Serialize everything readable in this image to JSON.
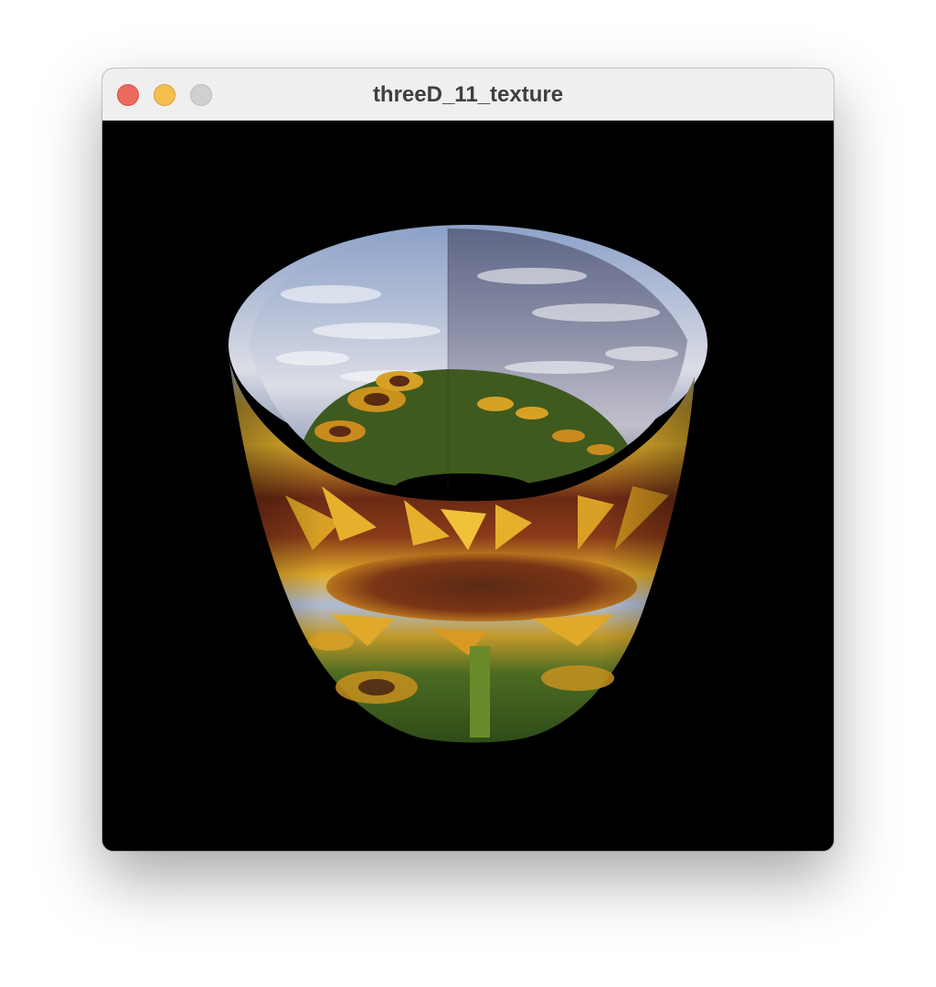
{
  "window": {
    "title": "threeD_11_texture",
    "background": "#000000"
  },
  "icons": {
    "close": "close-traffic-light",
    "minimize": "minimize-traffic-light",
    "zoom": "zoom-traffic-light"
  },
  "scene": {
    "object": "textured cylinder",
    "texture": "sunflower field under cloudy sky"
  }
}
